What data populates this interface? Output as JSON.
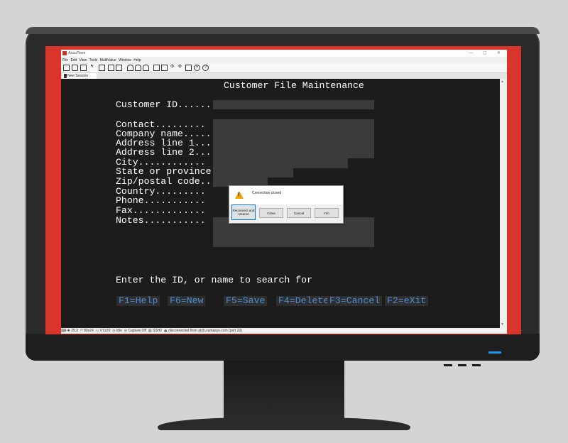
{
  "app": {
    "title": "AccuTerm",
    "window_controls": {
      "minimize": "—",
      "maximize": "▢",
      "close": "✕"
    }
  },
  "menu": [
    "File",
    "Edit",
    "View",
    "Tools",
    "MultiValue",
    "Window",
    "Help"
  ],
  "toolbar_icons": [
    "new-icon",
    "open-icon",
    "save-icon",
    "connect-icon",
    "print-icon",
    "copy-icon",
    "paste-icon",
    "upload-icon",
    "download-icon",
    "printer-icon",
    "script-icon",
    "settings-icon",
    "properties-icon",
    "gear-icon",
    "window-icon",
    "close-circle-icon",
    "help-icon"
  ],
  "tab": {
    "label": "New Session"
  },
  "terminal": {
    "heading": "Customer File Maintenance",
    "customer_id_label": "Customer ID......",
    "fields": [
      "Contact.........",
      "Company name.....",
      "Address line 1...",
      "Address line 2...",
      "City............",
      "State or province",
      "Zip/postal code..",
      "Country.........",
      "Phone...........",
      "Fax.............",
      "Notes..........."
    ],
    "prompt": "Enter the ID, or name to search for",
    "function_keys": [
      "F1=Help",
      "F6=New",
      "F5=Save",
      "F4=Delete",
      "F3=Cancel",
      "F2=eXit"
    ]
  },
  "dialog": {
    "message": "Connection closed",
    "buttons": {
      "reconnect": "Reconnect and resume",
      "close": "Close",
      "cancel": "Cancel",
      "info": "Info"
    }
  },
  "status": {
    "position": "25,3",
    "size": "80x24",
    "terminal_type": "VT220",
    "state": "Idle",
    "capture": "Capture Off",
    "protocol": "SSH2",
    "connection": "disconnected from atsb.zumasys.com (port 22)"
  },
  "colors": {
    "bezel": "#2a2a2a",
    "screen_border": "#d9352a",
    "terminal_bg": "#1c1c1c",
    "fkey_text": "#4d8fd6",
    "warning": "#f0a000",
    "power_led": "#1e9be8"
  }
}
